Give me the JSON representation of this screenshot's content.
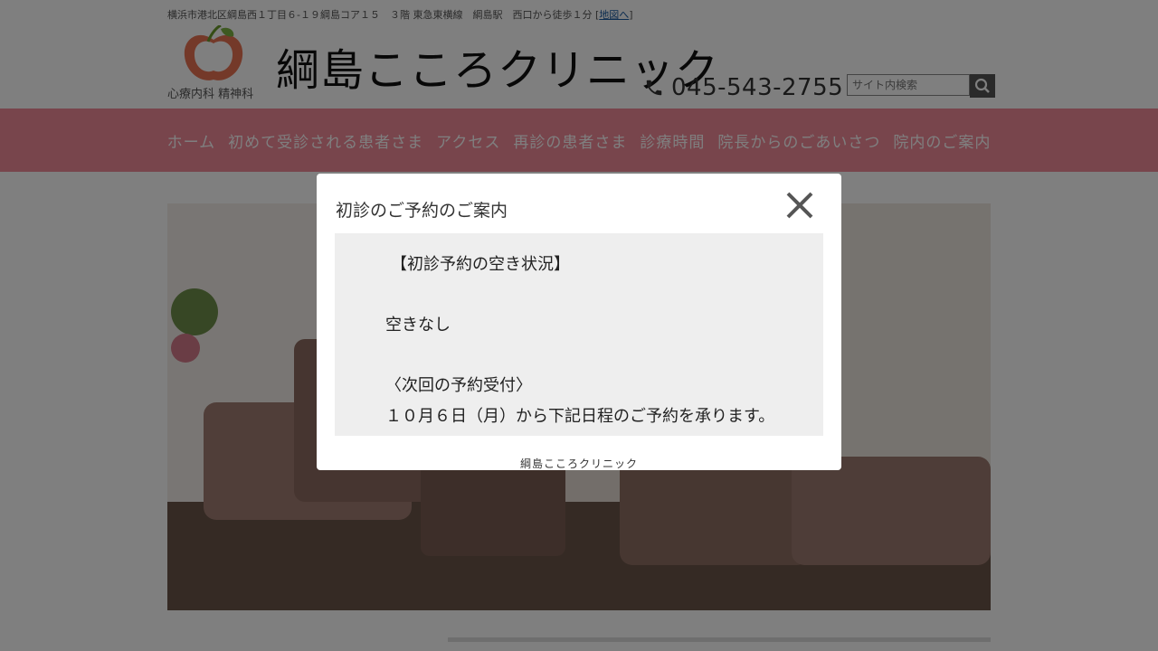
{
  "header": {
    "address": "横浜市港北区綱島西１丁目６-１９綱島コア１５　３階  東急東横線　綱島駅　西口から徒歩１分",
    "map_link_label": "地図へ",
    "logo_subtitle": "心療内科 精神科",
    "site_title": "綱島こころクリニック",
    "phone": "045-543-2755",
    "search_placeholder": "サイト内検索"
  },
  "nav": {
    "items": [
      "ホーム",
      "初めて受診される患者さま",
      "アクセス",
      "再診の患者さま",
      "診療時間",
      "院長からのごあいさつ",
      "院内のご案内"
    ]
  },
  "modal": {
    "title": "初診のご予約のご案内",
    "lines": [
      "【初診予約の空き状況】",
      "空きなし",
      "〈次回の予約受付〉",
      "１０月６日（月）から下記日程のご予約を承ります。"
    ],
    "footer": "綱島こころクリニック"
  },
  "colors": {
    "nav_bg": "#f08a99",
    "overlay": "rgba(0,0,0,0.5)",
    "modal_body_bg": "#eeeeee"
  }
}
